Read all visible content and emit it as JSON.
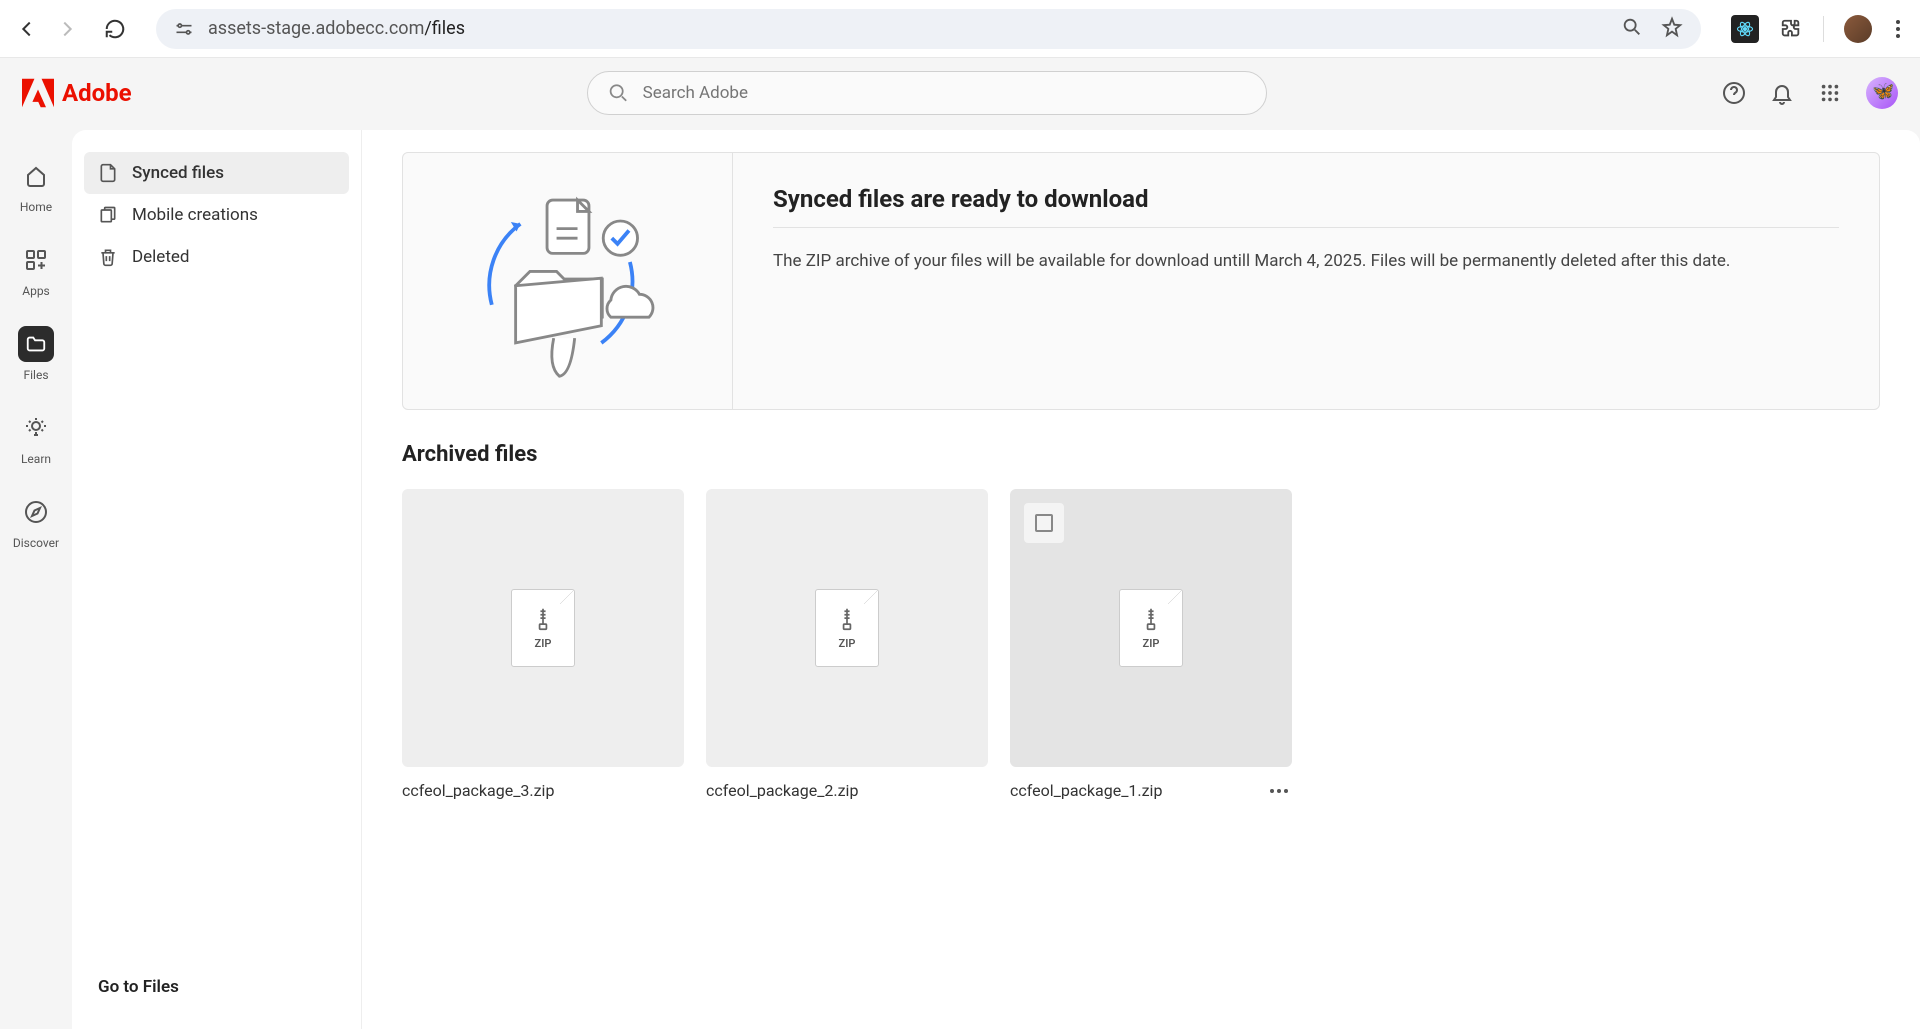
{
  "browser": {
    "url_host": "assets-stage.adobecc.com",
    "url_path": "/files"
  },
  "brand": "Adobe",
  "search": {
    "placeholder": "Search Adobe"
  },
  "rail": [
    {
      "id": "home",
      "label": "Home"
    },
    {
      "id": "apps",
      "label": "Apps"
    },
    {
      "id": "files",
      "label": "Files",
      "active": true
    },
    {
      "id": "learn",
      "label": "Learn"
    },
    {
      "id": "discover",
      "label": "Discover"
    }
  ],
  "sidebar": {
    "items": [
      {
        "label": "Synced files",
        "active": true
      },
      {
        "label": "Mobile creations"
      },
      {
        "label": "Deleted"
      }
    ],
    "footer": "Go to Files"
  },
  "banner": {
    "title": "Synced files are ready to download",
    "body": "The ZIP archive of your files will be available for download untill March 4, 2025. Files will be permanently deleted after this date."
  },
  "section_title": "Archived files",
  "files": [
    {
      "name": "ccfeol_package_3.zip",
      "type": "ZIP"
    },
    {
      "name": "ccfeol_package_2.zip",
      "type": "ZIP"
    },
    {
      "name": "ccfeol_package_1.zip",
      "type": "ZIP",
      "hover": true,
      "show_checkbox": true,
      "show_more": true
    }
  ]
}
